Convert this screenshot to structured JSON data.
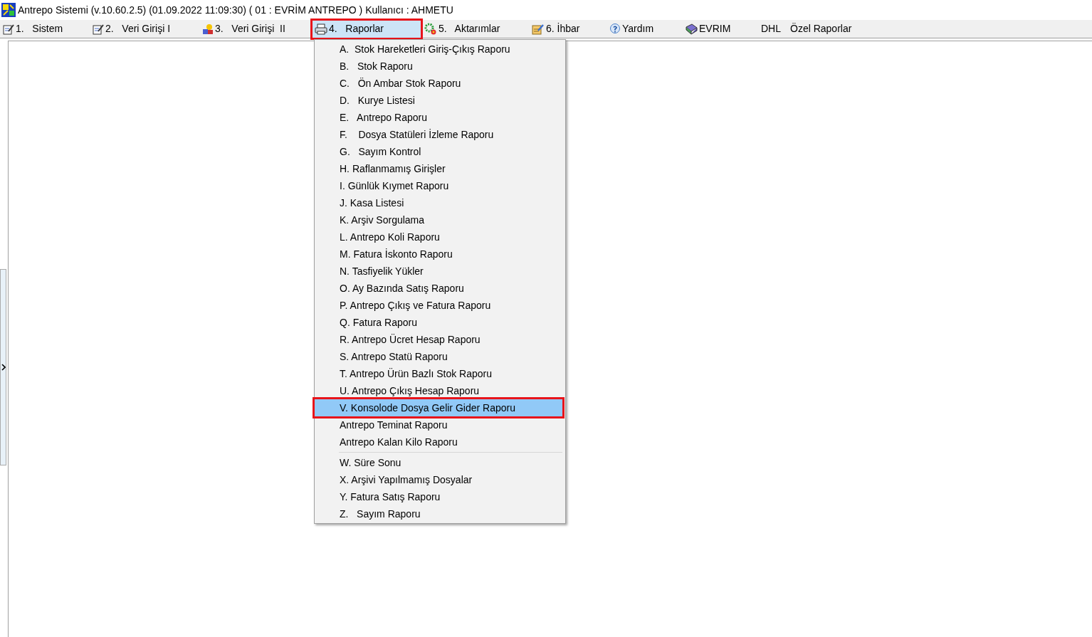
{
  "window": {
    "title": "Antrepo Sistemi (v.10.60.2.5) (01.09.2022 11:09:30) ( 01 : EVRİM ANTREPO ) Kullanıcı : AHMETU"
  },
  "menu_bar": [
    {
      "label": "1.   Sistem",
      "selected": false,
      "outlined": false
    },
    {
      "label": "2.   Veri Girişi I",
      "selected": false,
      "outlined": false
    },
    {
      "label": "3.   Veri Girişi  II",
      "selected": false,
      "outlined": false
    },
    {
      "label": "4.   Raporlar",
      "selected": true,
      "outlined": true
    },
    {
      "label": "5.   Aktarımlar",
      "selected": false,
      "outlined": false
    },
    {
      "label": "6. İhbar",
      "selected": false,
      "outlined": false
    },
    {
      "label": "Yardım",
      "selected": false,
      "outlined": false
    },
    {
      "label": "EVRIM",
      "selected": false,
      "outlined": false
    },
    {
      "label": "DHL",
      "selected": false,
      "outlined": false
    },
    {
      "label": "Özel Raporlar",
      "selected": false,
      "outlined": false
    }
  ],
  "dropdown_menu": [
    {
      "kind": "item",
      "label": "A.  Stok Hareketleri Giriş-Çıkış Raporu",
      "selected": false,
      "outlined": false
    },
    {
      "kind": "item",
      "label": "B.   Stok Raporu",
      "selected": false,
      "outlined": false
    },
    {
      "kind": "item",
      "label": "C.   Ön Ambar Stok Raporu",
      "selected": false,
      "outlined": false
    },
    {
      "kind": "item",
      "label": "D.   Kurye Listesi",
      "selected": false,
      "outlined": false
    },
    {
      "kind": "item",
      "label": "E.   Antrepo Raporu",
      "selected": false,
      "outlined": false
    },
    {
      "kind": "item",
      "label": "F.    Dosya Statüleri İzleme Raporu",
      "selected": false,
      "outlined": false
    },
    {
      "kind": "item",
      "label": "G.   Sayım Kontrol",
      "selected": false,
      "outlined": false
    },
    {
      "kind": "item",
      "label": "H. Raflanmamış Girişler",
      "selected": false,
      "outlined": false
    },
    {
      "kind": "item",
      "label": "I. Günlük Kıymet Raporu",
      "selected": false,
      "outlined": false
    },
    {
      "kind": "item",
      "label": "J. Kasa Listesi",
      "selected": false,
      "outlined": false
    },
    {
      "kind": "item",
      "label": "K. Arşiv Sorgulama",
      "selected": false,
      "outlined": false
    },
    {
      "kind": "item",
      "label": "L. Antrepo Koli Raporu",
      "selected": false,
      "outlined": false
    },
    {
      "kind": "item",
      "label": "M. Fatura İskonto Raporu",
      "selected": false,
      "outlined": false
    },
    {
      "kind": "item",
      "label": "N. Tasfiyelik Yükler",
      "selected": false,
      "outlined": false
    },
    {
      "kind": "item",
      "label": "O. Ay Bazında Satış Raporu",
      "selected": false,
      "outlined": false
    },
    {
      "kind": "item",
      "label": "P. Antrepo Çıkış ve Fatura Raporu",
      "selected": false,
      "outlined": false
    },
    {
      "kind": "item",
      "label": "Q. Fatura Raporu",
      "selected": false,
      "outlined": false
    },
    {
      "kind": "item",
      "label": "R. Antrepo Ücret Hesap Raporu",
      "selected": false,
      "outlined": false
    },
    {
      "kind": "item",
      "label": "S. Antrepo Statü Raporu",
      "selected": false,
      "outlined": false
    },
    {
      "kind": "item",
      "label": "T. Antrepo Ürün Bazlı Stok Raporu",
      "selected": false,
      "outlined": false
    },
    {
      "kind": "item",
      "label": "U. Antrepo Çıkış Hesap Raporu",
      "selected": false,
      "outlined": false
    },
    {
      "kind": "item",
      "label": "V. Konsolode Dosya Gelir Gider Raporu",
      "selected": true,
      "outlined": true
    },
    {
      "kind": "item",
      "label": "Antrepo Teminat Raporu",
      "selected": false,
      "outlined": false
    },
    {
      "kind": "item",
      "label": "Antrepo Kalan Kilo Raporu",
      "selected": false,
      "outlined": false
    },
    {
      "kind": "separator"
    },
    {
      "kind": "item",
      "label": "W. Süre Sonu",
      "selected": false,
      "outlined": false
    },
    {
      "kind": "item",
      "label": "X. Arşivi Yapılmamış Dosyalar",
      "selected": false,
      "outlined": false
    },
    {
      "kind": "item",
      "label": "Y. Fatura Satış Raporu",
      "selected": false,
      "outlined": false
    },
    {
      "kind": "item",
      "label": "Z.   Sayım Raporu",
      "selected": false,
      "outlined": false
    }
  ]
}
